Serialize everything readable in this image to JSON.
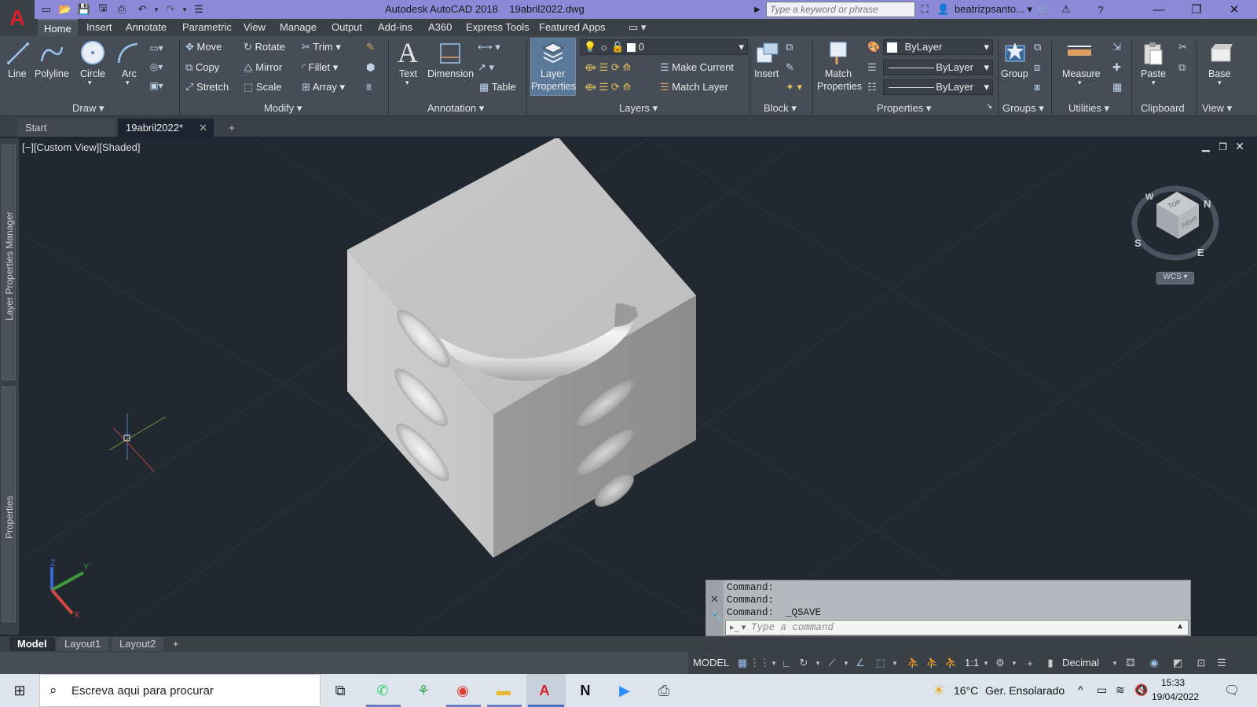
{
  "titlebar": {
    "app_title": "Autodesk AutoCAD 2018",
    "file_name": "19abril2022.dwg",
    "search_placeholder": "Type a keyword or phrase",
    "user_name": "beatrizpsanto..."
  },
  "menu": [
    "Home",
    "Insert",
    "Annotate",
    "Parametric",
    "View",
    "Manage",
    "Output",
    "Add-ins",
    "A360",
    "Express Tools",
    "Featured Apps"
  ],
  "ribbon": {
    "draw": {
      "line": "Line",
      "polyline": "Polyline",
      "circle": "Circle",
      "arc": "Arc",
      "title": "Draw"
    },
    "modify": {
      "move": "Move",
      "rotate": "Rotate",
      "trim": "Trim",
      "copy": "Copy",
      "mirror": "Mirror",
      "fillet": "Fillet",
      "stretch": "Stretch",
      "scale": "Scale",
      "array": "Array",
      "title": "Modify"
    },
    "annotation": {
      "text": "Text",
      "dimension": "Dimension",
      "table": "Table",
      "title": "Annotation"
    },
    "layers": {
      "layer_properties_1": "Layer",
      "layer_properties_2": "Properties",
      "current_layer": "0",
      "make_current": "Make Current",
      "match_layer": "Match Layer",
      "title": "Layers"
    },
    "block": {
      "insert": "Insert",
      "title": "Block"
    },
    "properties": {
      "match_1": "Match",
      "match_2": "Properties",
      "color": "ByLayer",
      "linetype": "ByLayer",
      "lineweight": "ByLayer",
      "title": "Properties"
    },
    "groups": {
      "group": "Group",
      "title": "Groups"
    },
    "utilities": {
      "measure": "Measure",
      "title": "Utilities"
    },
    "clipboard": {
      "paste": "Paste",
      "title": "Clipboard"
    },
    "view": {
      "base": "Base",
      "title": "View"
    }
  },
  "file_tabs": {
    "start": "Start",
    "drawing": "19abril2022*"
  },
  "viewport": {
    "label": "[−][Custom View][Shaded]",
    "wcs": "WCS"
  },
  "side_palettes": {
    "layer_manager": "Layer Properties Manager",
    "properties": "Properties"
  },
  "command": {
    "lines": [
      "Command:",
      "Command:",
      "Command:  _QSAVE"
    ],
    "placeholder": "Type a command"
  },
  "layout_tabs": {
    "model": "Model",
    "layout1": "Layout1",
    "layout2": "Layout2"
  },
  "statusbar": {
    "model": "MODEL",
    "scale": "1:1",
    "units": "Decimal"
  },
  "taskbar": {
    "search_placeholder": "Escreva aqui para procurar",
    "weather_temp": "16°C",
    "weather_desc": "Ger. Ensolarado",
    "time": "15:33",
    "date": "19/04/2022"
  },
  "colors": {
    "accent": "#8c89d8",
    "ribbon": "#474d57",
    "viewport": "#212830",
    "autocad_red": "#d8202c"
  }
}
